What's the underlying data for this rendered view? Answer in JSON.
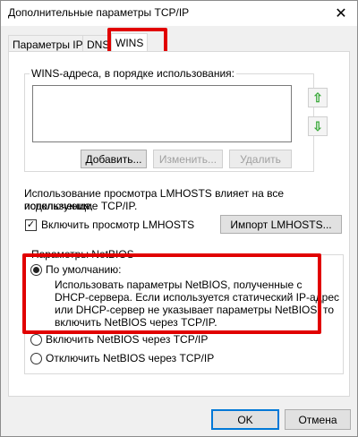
{
  "window": {
    "title": "Дополнительные параметры TCP/IP",
    "close_glyph": "✕"
  },
  "tabs": [
    {
      "label": "Параметры IP"
    },
    {
      "label": "DNS"
    },
    {
      "label": "WINS"
    }
  ],
  "wins": {
    "group_label": "WINS-адреса, в порядке использования:",
    "add_label": "Добавить...",
    "edit_label": "Изменить...",
    "remove_label": "Удалить",
    "up_glyph": "⇧",
    "down_glyph": "⇩"
  },
  "lmhosts": {
    "description_line1": "Использование просмотра LMHOSTS влияет на все подключения,",
    "description_line2": "использующие TCP/IP.",
    "enable_label": "Включить просмотр LMHOSTS",
    "enable_checked": true,
    "check_glyph": "✓",
    "import_label": "Импорт LMHOSTS..."
  },
  "netbios": {
    "group_label": "Параметры NetBIOS",
    "default_label": "По умолчанию:",
    "default_desc_1": "Использовать параметры NetBIOS, полученные с",
    "default_desc_2": "DHCP-сервера. Если используется статический IP-адрес",
    "default_desc_3": "или DHCP-сервер не указывает параметры NetBIOS, то",
    "default_desc_4": "включить NetBIOS через TCP/IP.",
    "enable_label": "Включить NetBIOS через TCP/IP",
    "disable_label": "Отключить NetBIOS через TCP/IP",
    "selected": "default"
  },
  "footer": {
    "ok_label": "OK",
    "cancel_label": "Отмена"
  },
  "colors": {
    "highlight": "#e10000",
    "arrow": "#3caa3c",
    "default_button_border": "#0078d7"
  }
}
